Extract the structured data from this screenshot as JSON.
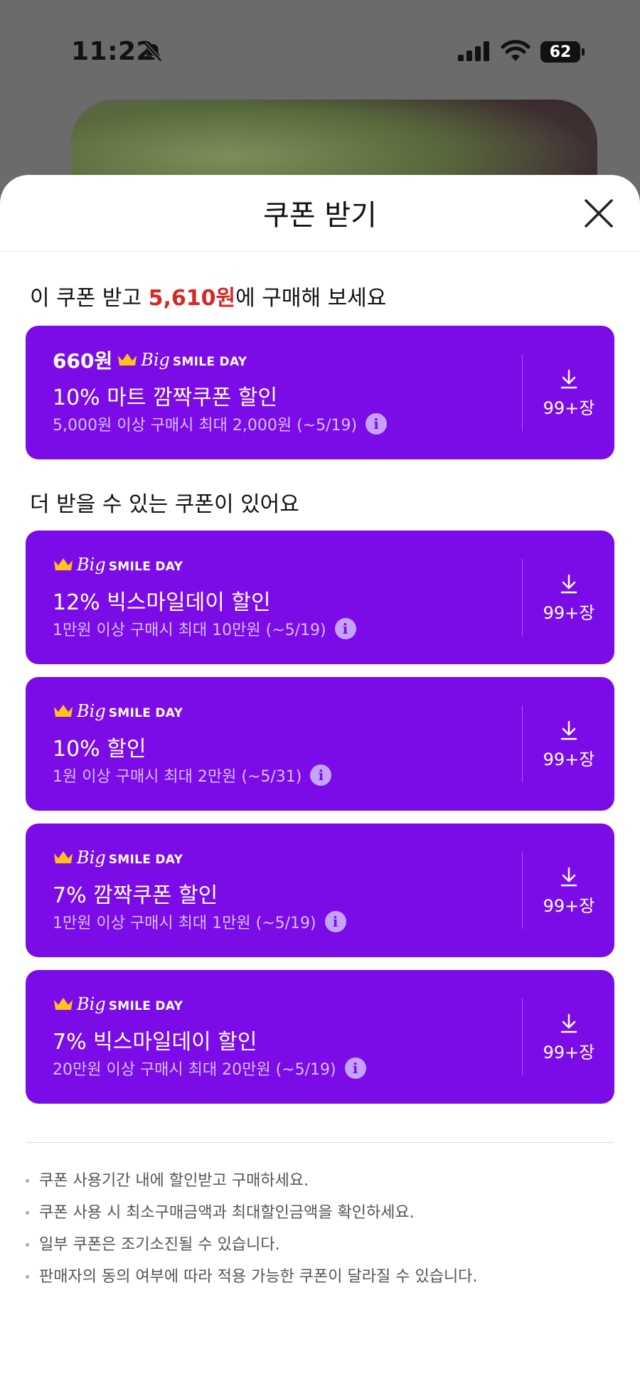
{
  "status_bar": {
    "time": "11:22",
    "battery": "62"
  },
  "sheet": {
    "title": "쿠폰 받기"
  },
  "best_section": {
    "prefix": "이 쿠폰 받고 ",
    "price": "5,610원",
    "suffix": "에 구매해 보세요"
  },
  "more_section": {
    "heading": "더 받을 수 있는 쿠폰이 있어요"
  },
  "badge": {
    "big": "Big",
    "smile_day": "SMILE DAY"
  },
  "coupons": [
    {
      "amount": "660원",
      "title": "10% 마트 깜짝쿠폰 할인",
      "desc": "5,000원 이상 구매시 최대 2,000원 (~5/19)",
      "count": "99+장"
    },
    {
      "amount": "",
      "title": "12% 빅스마일데이 할인",
      "desc": "1만원 이상 구매시 최대 10만원 (~5/19)",
      "count": "99+장"
    },
    {
      "amount": "",
      "title": "10% 할인",
      "desc": "1원 이상 구매시 최대 2만원 (~5/31)",
      "count": "99+장"
    },
    {
      "amount": "",
      "title": "7% 깜짝쿠폰 할인",
      "desc": "1만원 이상 구매시 최대 1만원 (~5/19)",
      "count": "99+장"
    },
    {
      "amount": "",
      "title": "7% 빅스마일데이 할인",
      "desc": "20만원 이상 구매시 최대 20만원 (~5/19)",
      "count": "99+장"
    }
  ],
  "notes": [
    "쿠폰 사용기간 내에 할인받고 구매하세요.",
    "쿠폰 사용 시 최소구매금액과 최대할인금액을 확인하세요.",
    "일부 쿠폰은 조기소진될 수 있습니다.",
    "판매자의 동의 여부에 따라 적용 가능한 쿠폰이 달라질 수 있습니다."
  ],
  "colors": {
    "coupon_bg": "#7b0ce8",
    "price_accent": "#d42a24",
    "crown": "#ffc21a"
  },
  "icons": [
    "bell-slash-icon",
    "signal-icon",
    "wifi-icon",
    "close-icon",
    "crown-icon",
    "info-icon",
    "download-icon"
  ]
}
